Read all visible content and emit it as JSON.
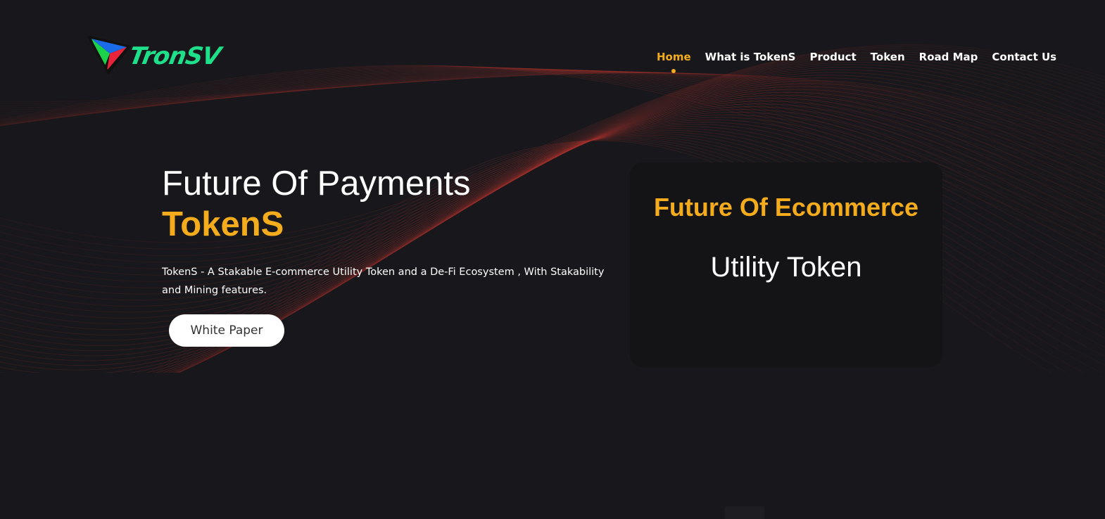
{
  "brand": {
    "logo_text": "TronSV",
    "logo_icon": "tricolor-triangle-logo-icon"
  },
  "nav": {
    "items": [
      {
        "label": "Home",
        "active": true
      },
      {
        "label": "What is TokenS",
        "active": false
      },
      {
        "label": "Product",
        "active": false
      },
      {
        "label": "Token",
        "active": false
      },
      {
        "label": "Road Map",
        "active": false
      },
      {
        "label": "Contact Us",
        "active": false
      }
    ]
  },
  "hero": {
    "title": "Future Of Payments",
    "brand_name": "TokenS",
    "description": "TokenS - A Stakable E-commerce Utility Token and a De-Fi Ecosystem , With Stakability and Mining features.",
    "cta_label": "White Paper"
  },
  "card": {
    "title": "Future Of Ecommerce",
    "subtitle": "Utility Token"
  },
  "colors": {
    "background": "#18181c",
    "accent": "#f4ac1c",
    "card_bg": "#141417",
    "wave": "#8a2a24",
    "logo_green": "#1fe08a"
  }
}
